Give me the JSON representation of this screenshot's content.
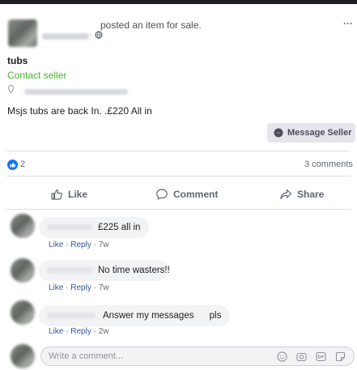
{
  "post": {
    "action_text": "posted an item for sale.",
    "more_menu": "···",
    "title": "tubs",
    "contact_label": "Contact seller",
    "description": "Msjs tubs are back In. .£220 All in",
    "message_seller_label": "Message Seller"
  },
  "engagement": {
    "reaction_count": "2",
    "comments_count": "3 comments"
  },
  "actions": {
    "like": "Like",
    "comment": "Comment",
    "share": "Share"
  },
  "comments": [
    {
      "text": "£225 all in",
      "like": "Like",
      "reply": "Reply",
      "time": "7w"
    },
    {
      "text": "No time wasters!!",
      "like": "Like",
      "reply": "Reply",
      "time": "7w"
    },
    {
      "text": "Answer my messages      pls",
      "like": "Like",
      "reply": "Reply",
      "time": "2w"
    }
  ],
  "composer": {
    "placeholder": "Write a comment..."
  },
  "colors": {
    "accent_blue": "#1877f2",
    "contact_green": "#42b72a",
    "link_blue": "#385898"
  },
  "icons": [
    "globe-icon",
    "location-pin-icon",
    "messenger-icon",
    "like-reaction-icon",
    "thumbs-up-icon",
    "comment-bubble-icon",
    "share-arrow-icon",
    "emoji-icon",
    "camera-icon",
    "gif-icon",
    "sticker-icon"
  ]
}
